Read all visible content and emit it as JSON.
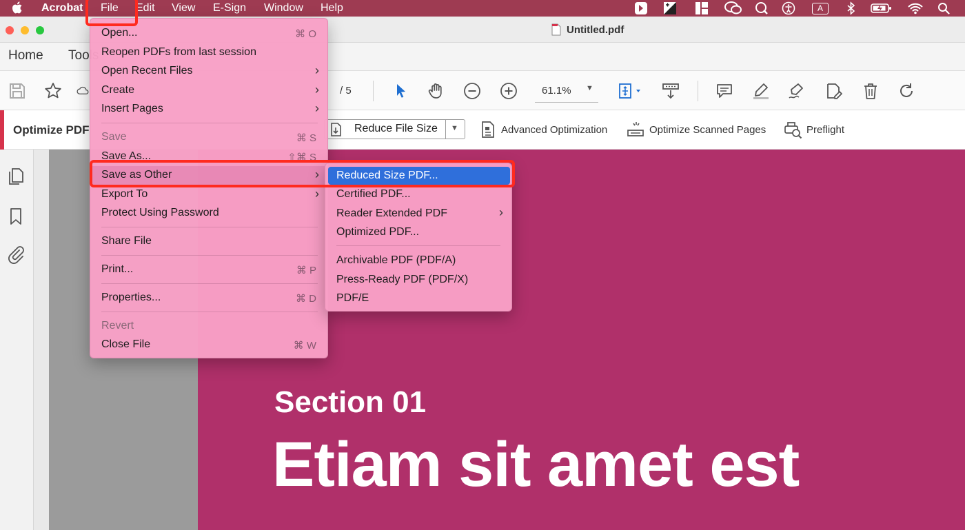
{
  "menubar": {
    "app_name": "Acrobat",
    "items": [
      "File",
      "Edit",
      "View",
      "E-Sign",
      "Window",
      "Help"
    ],
    "status_icons": [
      "acrobat-status-icon",
      "contrast-icon",
      "layout-icon",
      "wechat-icon",
      "qq-icon",
      "accessibility-icon",
      "input-source-icon",
      "bluetooth-icon",
      "battery-icon",
      "wifi-icon",
      "search-icon"
    ],
    "input_source_letter": "A",
    "bar_color": "#9e3b52"
  },
  "window": {
    "title": "Untitled.pdf"
  },
  "nav": {
    "home": "Home",
    "tools": "Tools"
  },
  "toolbar": {
    "page_total": "/ 5",
    "zoom": "61.1%",
    "icons": [
      "save-icon",
      "star-icon",
      "cloud-icon",
      "select-cursor-icon",
      "hand-icon",
      "zoom-out-icon",
      "zoom-in-icon",
      "fit-page-icon",
      "scroll-mode-icon",
      "comment-icon",
      "highlight-icon",
      "sign-icon",
      "edit-icon",
      "trash-icon",
      "rotate-icon"
    ]
  },
  "optimize": {
    "title": "Optimize PDF",
    "reduce_label": "Reduce File Size",
    "advanced": "Advanced Optimization",
    "scanned": "Optimize Scanned Pages",
    "preflight": "Preflight",
    "accent_color": "#d6334c"
  },
  "document": {
    "section": "Section 01",
    "headline": "Etiam sit amet est",
    "page_color": "#b0306a"
  },
  "file_menu": {
    "open": "Open...",
    "open_sc": "⌘ O",
    "reopen": "Reopen PDFs from last session",
    "open_recent": "Open Recent Files",
    "create": "Create",
    "insert_pages": "Insert Pages",
    "save": "Save",
    "save_sc": "⌘ S",
    "save_as": "Save As...",
    "save_as_sc": "⇧⌘ S",
    "save_as_other": "Save as Other",
    "export_to": "Export To",
    "protect": "Protect Using Password",
    "share": "Share File",
    "print": "Print...",
    "print_sc": "⌘ P",
    "properties": "Properties...",
    "properties_sc": "⌘ D",
    "revert": "Revert",
    "close": "Close File",
    "close_sc": "⌘ W"
  },
  "save_other_menu": {
    "reduced": "Reduced Size PDF...",
    "certified": "Certified PDF...",
    "reader_extended": "Reader Extended PDF",
    "optimized": "Optimized PDF...",
    "archivable": "Archivable PDF (PDF/A)",
    "press_ready": "Press-Ready PDF (PDF/X)",
    "pdfe": "PDF/E",
    "selected_color": "#2f6fdb"
  },
  "annotation_color": "#ff2a1f"
}
